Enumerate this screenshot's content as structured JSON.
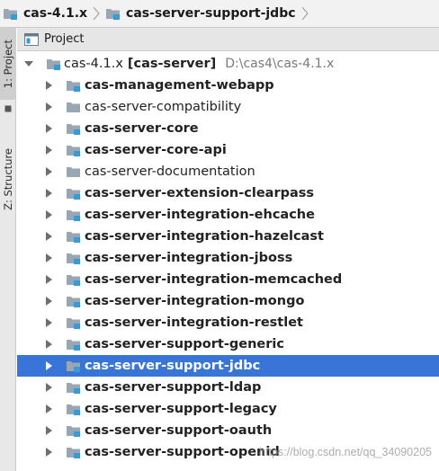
{
  "breadcrumb": {
    "items": [
      {
        "label": "cas-4.1.x",
        "icon": "module-folder-icon"
      },
      {
        "label": "cas-server-support-jdbc",
        "icon": "module-folder-icon"
      }
    ]
  },
  "toolstrip": {
    "project_tab": "1: Project",
    "structure_tab": "Z: Structure"
  },
  "panel": {
    "title": "Project",
    "icon": "project-view-icon"
  },
  "tree": {
    "root": {
      "name": "cas-4.1.x",
      "tag": "[cas-server]",
      "path": "D:\\cas4\\cas-4.1.x"
    },
    "items": [
      {
        "name": "cas-management-webapp",
        "module": true,
        "selected": false
      },
      {
        "name": "cas-server-compatibility",
        "module": false,
        "selected": false
      },
      {
        "name": "cas-server-core",
        "module": true,
        "selected": false
      },
      {
        "name": "cas-server-core-api",
        "module": true,
        "selected": false
      },
      {
        "name": "cas-server-documentation",
        "module": false,
        "selected": false
      },
      {
        "name": "cas-server-extension-clearpass",
        "module": true,
        "selected": false
      },
      {
        "name": "cas-server-integration-ehcache",
        "module": true,
        "selected": false
      },
      {
        "name": "cas-server-integration-hazelcast",
        "module": true,
        "selected": false
      },
      {
        "name": "cas-server-integration-jboss",
        "module": true,
        "selected": false
      },
      {
        "name": "cas-server-integration-memcached",
        "module": true,
        "selected": false
      },
      {
        "name": "cas-server-integration-mongo",
        "module": true,
        "selected": false
      },
      {
        "name": "cas-server-integration-restlet",
        "module": true,
        "selected": false
      },
      {
        "name": "cas-server-support-generic",
        "module": true,
        "selected": false
      },
      {
        "name": "cas-server-support-jdbc",
        "module": true,
        "selected": true
      },
      {
        "name": "cas-server-support-ldap",
        "module": true,
        "selected": false
      },
      {
        "name": "cas-server-support-legacy",
        "module": true,
        "selected": false
      },
      {
        "name": "cas-server-support-oauth",
        "module": true,
        "selected": false
      },
      {
        "name": "cas-server-support-openid",
        "module": true,
        "selected": false
      }
    ]
  },
  "watermark": "https://blog.csdn.net/qq_34090205",
  "colors": {
    "selection": "#3875d7",
    "module_badge": "#3c9ad0",
    "folder": "#9aa7b3"
  }
}
